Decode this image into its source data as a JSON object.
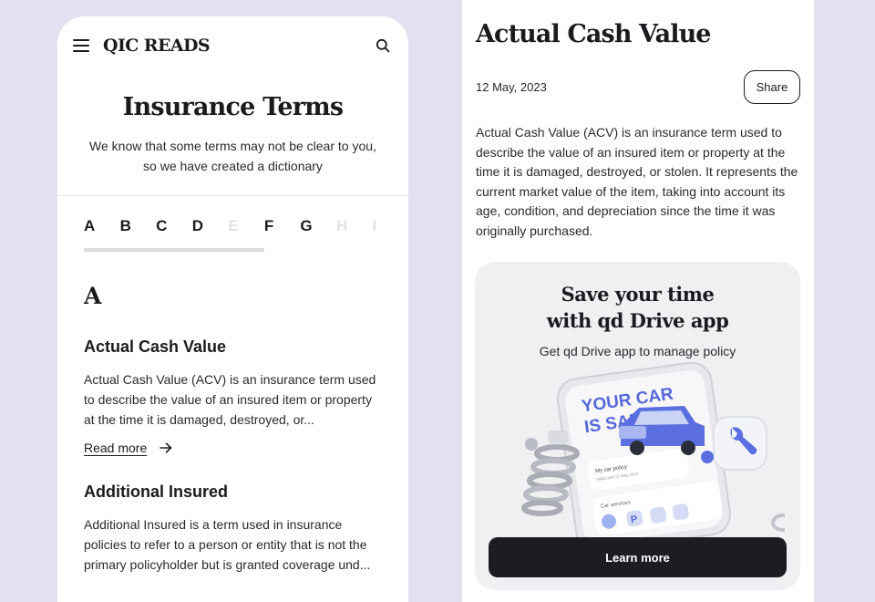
{
  "left": {
    "header": {
      "logo": "QIC READS",
      "menu_icon": "menu-icon",
      "search_icon": "search-icon"
    },
    "title": "Insurance Terms",
    "subtitle": "We know that some terms may not be clear to you, so we have created a dictionary",
    "alphabet": [
      {
        "letter": "A",
        "enabled": true
      },
      {
        "letter": "B",
        "enabled": true
      },
      {
        "letter": "C",
        "enabled": true
      },
      {
        "letter": "D",
        "enabled": true
      },
      {
        "letter": "E",
        "enabled": false
      },
      {
        "letter": "F",
        "enabled": true
      },
      {
        "letter": "G",
        "enabled": true
      },
      {
        "letter": "H",
        "enabled": false
      },
      {
        "letter": "I",
        "enabled": false
      }
    ],
    "section_letter": "A",
    "terms": [
      {
        "title": "Actual Cash Value",
        "description": "Actual Cash Value (ACV) is an insurance term used to describe the value of an insured item or property at the time it is damaged, destroyed, or...",
        "read_more": "Read more"
      },
      {
        "title": "Additional Insured",
        "description": "Additional Insured is a term used in insurance policies to refer to a person or entity that is not the primary policyholder but is granted coverage und..."
      }
    ]
  },
  "right": {
    "title": "Actual Cash Value",
    "date": "12 May, 2023",
    "share_label": "Share",
    "body": "Actual Cash Value (ACV) is an insurance term used to describe the value of an insured item or property at the time it is damaged, destroyed, or stolen. It represents the current market value of the item, taking into account its age, condition, and depreciation since the time it was originally purchased.",
    "promo": {
      "title_line1": "Save your time",
      "title_line2": "with qd Drive app",
      "subtitle": "Get qd Drive app to manage policy",
      "illustration": {
        "headline_line1": "YOUR CAR",
        "headline_line2": "IS SAFE",
        "policy_label": "My car policy",
        "policy_sub": "Valid until 21 May 2024",
        "services_label": "Car services"
      },
      "button_label": "Learn more"
    }
  }
}
